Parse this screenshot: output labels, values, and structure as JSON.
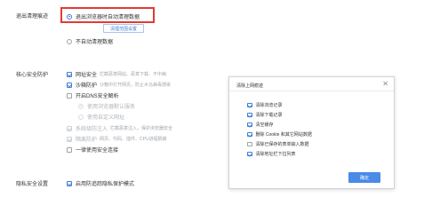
{
  "sections": {
    "exit_clear": {
      "label": "退出清理痕迹",
      "option_auto": "退出浏览器时自动清理数据",
      "clear_settings_button": "清理范围设置",
      "option_manual": "不自动清理数据"
    },
    "core_security": {
      "label": "核心安全防护",
      "items": [
        {
          "label": "网址安全",
          "hint": "拦截恶意网站、恶意下载、不中病",
          "checked": true
        },
        {
          "label": "沙箱防护",
          "hint": "沙箱中打开网页，防止木马病毒感染",
          "checked": true
        },
        {
          "label": "开启DNS安全解析",
          "hint": "",
          "checked": false
        }
      ],
      "dns_options": [
        "使用浏览器默认服务",
        "使用自定义网址"
      ],
      "disabled_items": [
        {
          "label": "系统级防注入",
          "hint": "拦截恶意注入，保护浏览器安全",
          "checked": true
        },
        {
          "label": "隔离防护",
          "hint": "网页、代码、插件、CPU进程隔离",
          "checked": true
        }
      ],
      "last_item": {
        "label": "一律使用安全连接",
        "checked": false
      }
    },
    "privacy": {
      "label": "隐私安全设置",
      "item": "启用防追踪隐私保护模式"
    }
  },
  "dialog": {
    "title": "清除上网痕迹",
    "close_glyph": "✕",
    "items": [
      {
        "label": "清除浏览记录",
        "checked": true
      },
      {
        "label": "清除下载记录",
        "checked": true
      },
      {
        "label": "清空缓存",
        "checked": true
      },
      {
        "label": "删除 Cookie 和其它网站数据",
        "checked": true
      },
      {
        "label": "清除已保存的表单输入数据",
        "checked": false
      },
      {
        "label": "清除地址栏下拉列表",
        "checked": true
      }
    ],
    "ok_button": "确定"
  }
}
